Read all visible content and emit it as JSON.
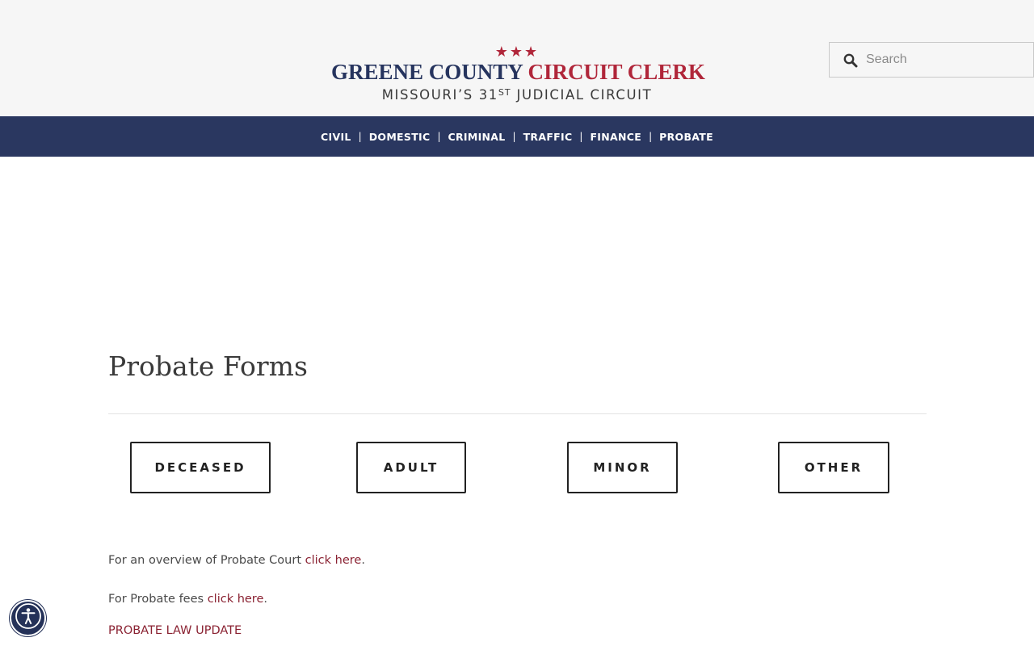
{
  "header": {
    "logo": {
      "stars": "★★★",
      "line1_part1": "GREENE COUNTY",
      "line1_part2": "CIRCUIT CLERK",
      "line2_main": "MISSOURI’S 31",
      "line2_sup": "ST",
      "line2_end": "JUDICIAL CIRCUIT"
    },
    "search": {
      "placeholder": "Search",
      "value": "",
      "icon": "search-icon"
    }
  },
  "nav": {
    "items": [
      {
        "label": "CIVIL"
      },
      {
        "label": "DOMESTIC"
      },
      {
        "label": "CRIMINAL"
      },
      {
        "label": "TRAFFIC"
      },
      {
        "label": "FINANCE"
      },
      {
        "label": "PROBATE"
      }
    ],
    "separator": "|"
  },
  "main": {
    "title": "Probate Forms",
    "buttons": [
      {
        "label": "DECEASED"
      },
      {
        "label": "ADULT"
      },
      {
        "label": "MINOR"
      },
      {
        "label": "OTHER"
      }
    ],
    "overview": {
      "text": "For an overview of Probate Court ",
      "link": "click here",
      "end": "."
    },
    "fees": {
      "text": "For Probate fees ",
      "link": "click here",
      "end": "."
    },
    "law_update": "PROBATE LAW UPDATE"
  },
  "accessibility": {
    "icon": "accessibility-icon"
  },
  "colors": {
    "navy": "#2a3760",
    "brand_red": "#b0263a",
    "link": "#8a2232",
    "header_bg": "#f6f6f6"
  }
}
